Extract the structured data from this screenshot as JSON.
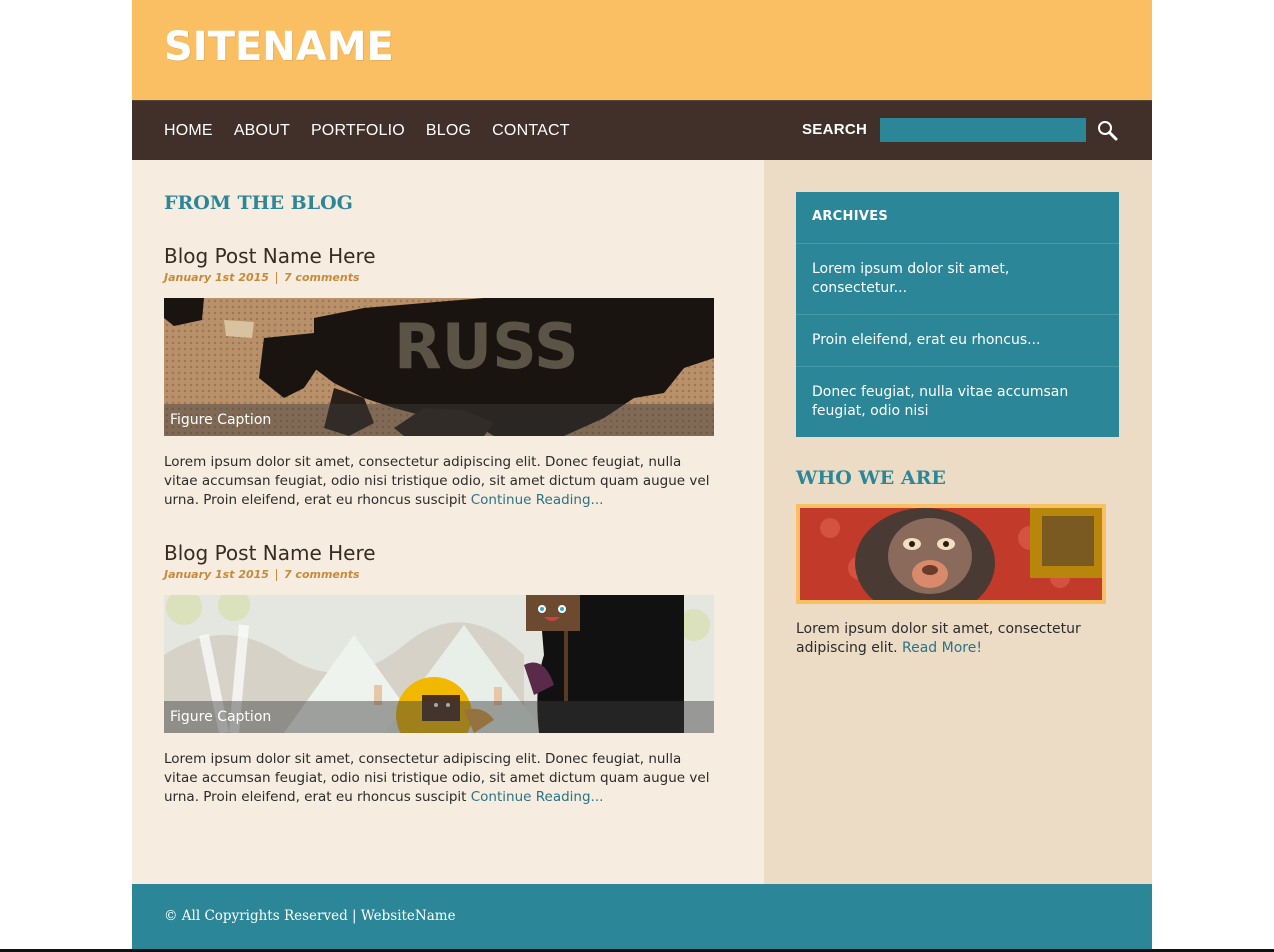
{
  "header": {
    "site_name": "SITENAME"
  },
  "nav": {
    "items": [
      {
        "label": "HOME"
      },
      {
        "label": "ABOUT"
      },
      {
        "label": "PORTFOLIO"
      },
      {
        "label": "BLOG"
      },
      {
        "label": "CONTACT"
      }
    ],
    "search_label": "SEARCH",
    "search_value": "",
    "search_icon": "magnifier-icon"
  },
  "main": {
    "section_title": "FROM THE BLOG",
    "posts": [
      {
        "title": "Blog Post Name Here",
        "date": "January 1st 2015",
        "comments": "7 comments",
        "caption": "Figure Caption",
        "excerpt": "Lorem ipsum dolor sit amet, consectetur adipiscing elit. Donec feugiat, nulla vitae accumsan feugiat, odio nisi tristique odio, sit amet dictum quam augue vel urna. Proin eleifend, erat eu rhoncus suscipit",
        "read_more": "Continue Reading..."
      },
      {
        "title": "Blog Post Name Here",
        "date": "January 1st 2015",
        "comments": "7 comments",
        "caption": "Figure Caption",
        "excerpt": "Lorem ipsum dolor sit amet, consectetur adipiscing elit. Donec feugiat, nulla vitae accumsan feugiat, odio nisi tristique odio, sit amet dictum quam augue vel urna. Proin eleifend, erat eu rhoncus suscipit",
        "read_more": "Continue Reading..."
      }
    ]
  },
  "sidebar": {
    "archives": {
      "title": "ARCHIVES",
      "items": [
        {
          "label": "Lorem ipsum dolor sit amet, consectetur..."
        },
        {
          "label": "Proin eleifend, erat eu rhoncus..."
        },
        {
          "label": "Donec feugiat, nulla vitae accumsan feugiat, odio nisi"
        }
      ]
    },
    "who_we_are": {
      "title": "WHO WE ARE",
      "text": "Lorem ipsum dolor sit amet, consectetur adipiscing elit.",
      "read_more": "Read More!"
    }
  },
  "footer": {
    "text": "© All Copyrights Reserved | WebsiteName"
  },
  "colors": {
    "header_bg": "#fbbf63",
    "nav_bg": "#41302a",
    "accent": "#2b8798",
    "content_bg": "#f6ecdf",
    "sidebar_bg": "#ecdcc6",
    "meta": "#c58b3b"
  }
}
